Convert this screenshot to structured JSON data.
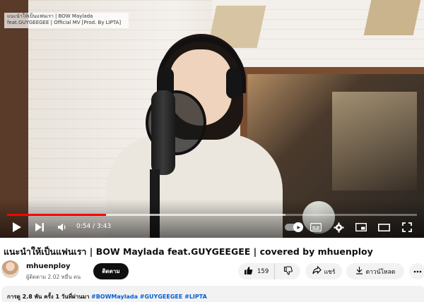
{
  "player": {
    "overlay_title_line1": "แนะนำให้เป็นแฟนเรา | BOW Maylada",
    "overlay_title_line2": "feat.GUYGEEGEE | Official MV [Prod. By LIPTA]",
    "time_display": "0:54 / 3:43",
    "progress_fraction": 0.2422,
    "buffer_fraction": 0.68,
    "accent_color": "#ff0000",
    "icons": [
      "play-icon",
      "next-icon",
      "volume-icon",
      "autoplay-toggle",
      "subtitles-icon",
      "gear-icon",
      "miniplayer-icon",
      "theater-icon",
      "fullscreen-icon"
    ]
  },
  "video": {
    "title": "แนะนำให้เป็นแฟนเรา | BOW Maylada feat.GUYGEEGEE | covered by mhuenploy"
  },
  "channel": {
    "name": "mhuenploy",
    "subscribers": "ผู้ติดตาม 2.02 หมื่น คน",
    "subscribe_label": "ติดตาม"
  },
  "actions": {
    "like_count": "159",
    "share_label": "แชร์",
    "download_label": "ดาวน์โหลด",
    "more_icon": "more-icon"
  },
  "description": {
    "views_line": "การดู 2.8 พัน ครั้ง  1 วันที่ผ่านมา",
    "tags": "#BOWMaylada #GUYGEEGEE #LIPTA"
  }
}
